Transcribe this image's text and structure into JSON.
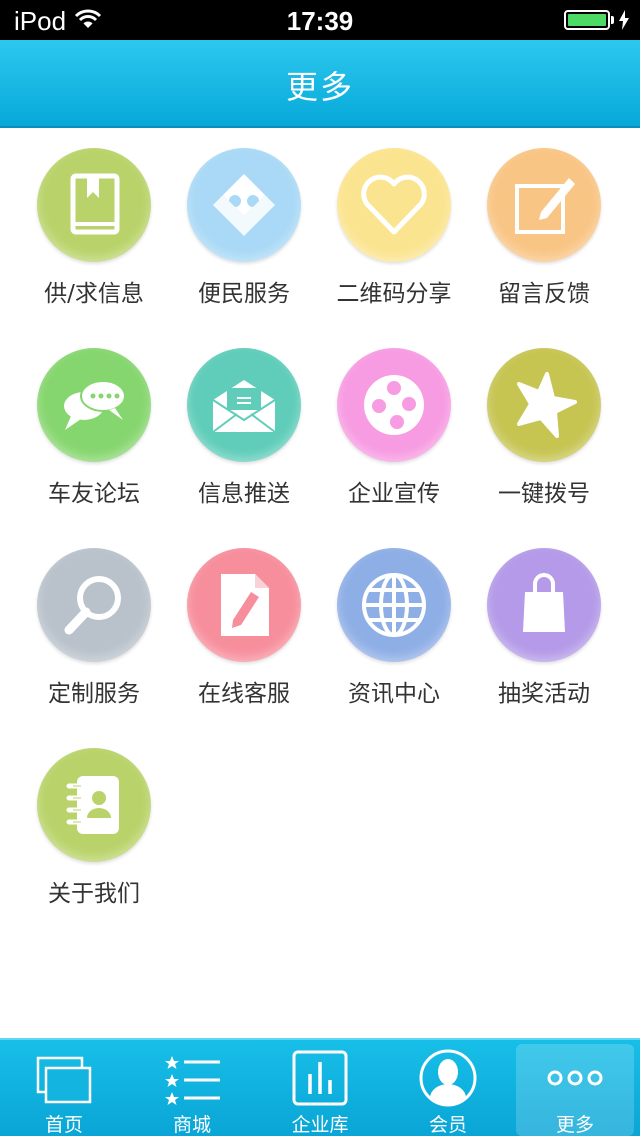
{
  "status_bar": {
    "device": "iPod",
    "time": "17:39",
    "battery_level": 1.0
  },
  "nav": {
    "title": "更多"
  },
  "grid": {
    "items": [
      {
        "label": "供/求信息",
        "icon": "book-icon",
        "color": "#b9d36a"
      },
      {
        "label": "便民服务",
        "icon": "puzzle-icon",
        "color": "#a9d9f6"
      },
      {
        "label": "二维码分享",
        "icon": "heart-icon",
        "color": "#fbe48f"
      },
      {
        "label": "留言反馈",
        "icon": "edit-icon",
        "color": "#f9c585"
      },
      {
        "label": "车友论坛",
        "icon": "chat-icon",
        "color": "#86d66f"
      },
      {
        "label": "信息推送",
        "icon": "mail-icon",
        "color": "#5fcdb9"
      },
      {
        "label": "企业宣传",
        "icon": "film-reel-icon",
        "color": "#f79be2"
      },
      {
        "label": "一键拨号",
        "icon": "star-icon",
        "color": "#c6c552"
      },
      {
        "label": "定制服务",
        "icon": "magnifier-icon",
        "color": "#b9c2cb"
      },
      {
        "label": "在线客服",
        "icon": "document-pencil-icon",
        "color": "#f78e9c"
      },
      {
        "label": "资讯中心",
        "icon": "globe-icon",
        "color": "#8eaee6"
      },
      {
        "label": "抽奖活动",
        "icon": "shopping-bag-icon",
        "color": "#b49ae8"
      },
      {
        "label": "关于我们",
        "icon": "contact-book-icon",
        "color": "#b9d36a"
      }
    ]
  },
  "tabs": [
    {
      "label": "首页",
      "icon": "home-windows-icon",
      "active": false
    },
    {
      "label": "商城",
      "icon": "star-list-icon",
      "active": false
    },
    {
      "label": "企业库",
      "icon": "bar-chart-icon",
      "active": false
    },
    {
      "label": "会员",
      "icon": "user-avatar-icon",
      "active": false
    },
    {
      "label": "更多",
      "icon": "more-dots-icon",
      "active": true
    }
  ]
}
